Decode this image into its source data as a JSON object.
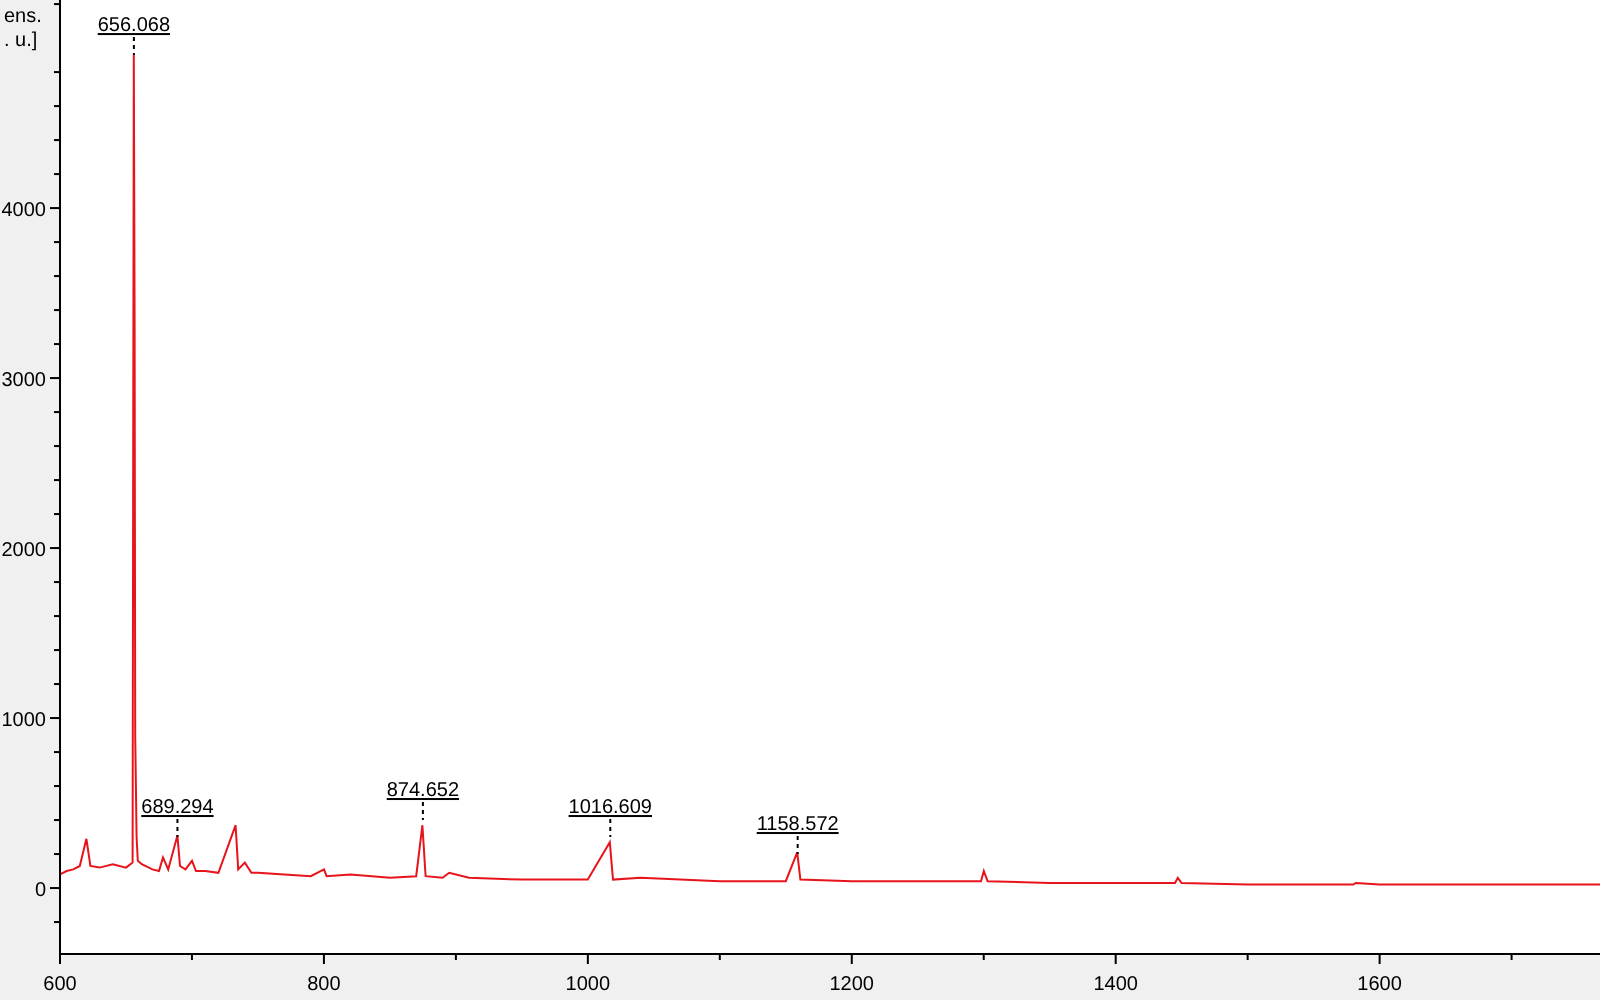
{
  "chart_data": {
    "type": "line",
    "ylabel": "ens.\n. u.]",
    "xlim": [
      600,
      1767
    ],
    "ylim": [
      -388,
      5224
    ],
    "xticks": [
      600,
      800,
      1000,
      1200,
      1400,
      1600
    ],
    "yticks": [
      0,
      1000,
      2000,
      3000,
      4000
    ],
    "x": [
      600,
      605,
      610,
      615,
      620,
      623,
      630,
      640,
      650,
      655,
      656,
      656.5,
      657,
      658,
      659,
      662,
      670,
      675,
      678,
      682,
      689,
      691,
      695,
      700,
      703,
      710,
      720,
      733,
      735,
      740,
      745,
      750,
      770,
      790,
      800,
      802,
      820,
      850,
      870,
      874.6,
      877,
      890,
      895,
      910,
      950,
      1000,
      1016.6,
      1019,
      1040,
      1100,
      1150,
      1158.6,
      1161,
      1200,
      1250,
      1298,
      1300,
      1303,
      1350,
      1400,
      1445,
      1447,
      1450,
      1500,
      1550,
      1580,
      1582,
      1600,
      1650,
      1700,
      1767
    ],
    "series": [
      {
        "color": "#e8141c",
        "values": [
          80,
          100,
          110,
          130,
          290,
          130,
          120,
          140,
          120,
          150,
          4900,
          3340,
          900,
          300,
          160,
          140,
          110,
          100,
          180,
          110,
          310,
          130,
          110,
          160,
          100,
          100,
          90,
          370,
          110,
          150,
          90,
          90,
          80,
          70,
          110,
          70,
          80,
          60,
          70,
          370,
          70,
          60,
          90,
          60,
          50,
          50,
          270,
          50,
          60,
          40,
          40,
          210,
          50,
          40,
          40,
          40,
          100,
          40,
          30,
          30,
          30,
          60,
          30,
          20,
          20,
          20,
          30,
          20,
          20,
          20,
          20
        ]
      }
    ],
    "annotations": [
      {
        "x": 656,
        "y": 4900,
        "text": "656.068"
      },
      {
        "x": 689,
        "y": 300,
        "text": "689.294"
      },
      {
        "x": 875,
        "y": 400,
        "text": "874.652"
      },
      {
        "x": 1017,
        "y": 300,
        "text": "1016.609"
      },
      {
        "x": 1159,
        "y": 200,
        "text": "1158.572"
      }
    ]
  }
}
